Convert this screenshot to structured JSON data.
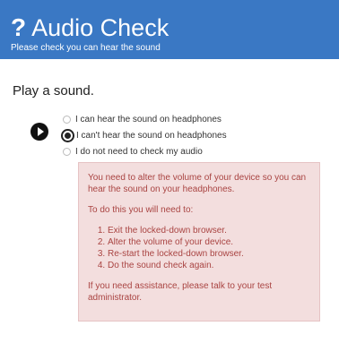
{
  "header": {
    "icon": "question-mark-icon",
    "icon_glyph": "?",
    "title": "Audio Check",
    "subtitle": "Please check you can hear the sound",
    "bg_color": "#3a78c4"
  },
  "prompt": "Play a sound.",
  "play_button": {
    "icon": "play-icon"
  },
  "options": [
    {
      "label": "I can hear the sound on headphones",
      "selected": false
    },
    {
      "label": "I can't hear the sound on headphones",
      "selected": true
    },
    {
      "label": "I do not need to check my audio",
      "selected": false
    }
  ],
  "alert": {
    "bg_color": "#f3dede",
    "text_color": "#a94442",
    "intro": "You need to alter the volume of your device so you can hear the sound on your headphones.",
    "steps_intro": "To do this you will need to:",
    "steps": [
      "Exit the locked-down browser.",
      "Alter the volume of your device.",
      "Re-start the locked-down browser.",
      "Do the sound check again."
    ],
    "footer": "If you need assistance, please talk to your test administrator."
  }
}
